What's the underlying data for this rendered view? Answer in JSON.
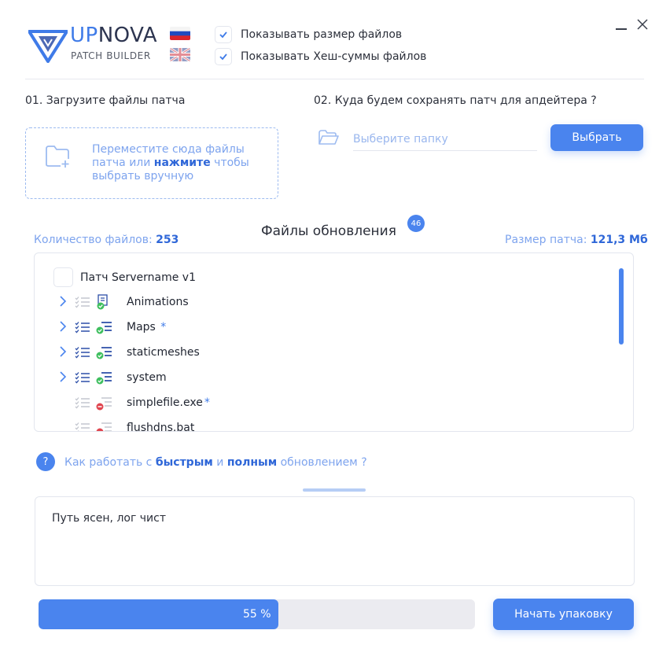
{
  "header": {
    "brand_up": "UP",
    "brand_nova": "NOVA",
    "brand_sub": "PATCH BUILDER",
    "languages": [
      {
        "code": "ru",
        "name": "Russian flag",
        "active": true
      },
      {
        "code": "en",
        "name": "UK flag",
        "active": false
      }
    ],
    "options": [
      {
        "label": "Показывать размер файлов",
        "checked": true
      },
      {
        "label": "Показывать Хеш-суммы файлов",
        "checked": true
      }
    ]
  },
  "step1": {
    "title": "01. Загрузите файлы патча",
    "drop_line1": "Переместите сюда файлы",
    "drop_line2_a": "патча или ",
    "drop_line2_link": "нажмите",
    "drop_line2_b": " чтобы",
    "drop_line3": "выбрать вручную"
  },
  "step2": {
    "title": "02. Куда будем сохранять патч для апдейтера ?",
    "folder_value": "",
    "folder_placeholder": "Выберите папку",
    "choose_button": "Выбрать"
  },
  "files": {
    "title": "Файлы обновления",
    "badge": "46",
    "count_label": "Количество файлов: ",
    "count_value": "253",
    "size_label": "Размер патча: ",
    "size_value": "121,3 Мб",
    "root_label": "Патч Servername v1",
    "rows": [
      {
        "name": "Animations",
        "star": "",
        "expandable": true,
        "status": "ok-doc",
        "list_active": false
      },
      {
        "name": "Maps",
        "star": " *",
        "expandable": true,
        "status": "ok",
        "list_active": true
      },
      {
        "name": "staticmeshes",
        "star": "",
        "expandable": true,
        "status": "ok",
        "list_active": true
      },
      {
        "name": "system",
        "star": "",
        "expandable": true,
        "status": "ok",
        "list_active": true
      },
      {
        "name": "simplefile.exe",
        "star": "*",
        "expandable": false,
        "status": "remove",
        "list_active": false
      },
      {
        "name": "flushdns.bat",
        "star": "",
        "expandable": false,
        "status": "remove",
        "list_active": false
      }
    ]
  },
  "help": {
    "icon": "?",
    "t1": "Как работать с ",
    "fast": "быстрым",
    "t2": " и ",
    "full": "полным",
    "t3": " обновлением ?"
  },
  "log": {
    "text": "Путь ясен, лог чист"
  },
  "progress": {
    "percent": 0.55,
    "label": "55 %"
  },
  "start_button": "Начать упаковку",
  "colors": {
    "accent": "#4a84ee",
    "accent_dark": "#2f67d8",
    "accent_light": "#7ea4ee",
    "ok": "#3fbf5f",
    "remove": "#e0454f"
  }
}
